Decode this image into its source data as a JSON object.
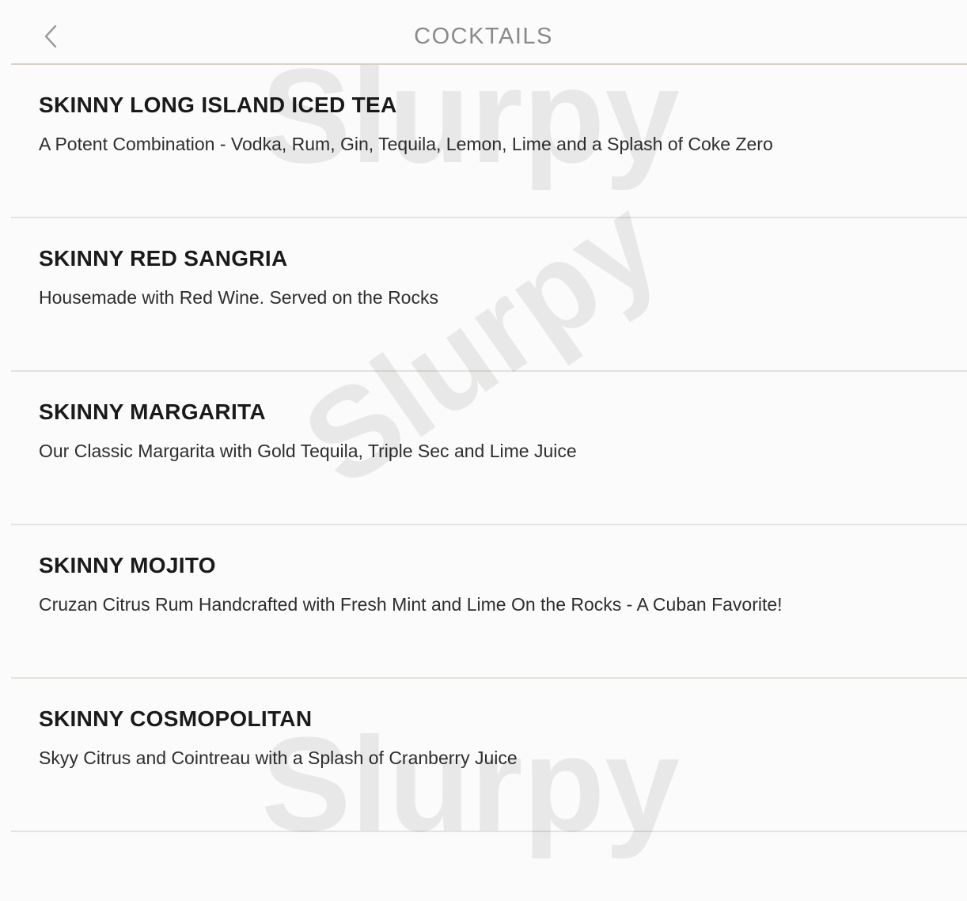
{
  "header": {
    "title": "COCKTAILS",
    "back_icon": "chevron-left-icon"
  },
  "menu": {
    "items": [
      {
        "name": "SKINNY LONG ISLAND ICED TEA",
        "description": "A Potent Combination - Vodka, Rum, Gin, Tequila, Lemon, Lime and a Splash of Coke Zero"
      },
      {
        "name": "SKINNY RED SANGRIA",
        "description": "Housemade with Red Wine. Served on the Rocks"
      },
      {
        "name": "SKINNY MARGARITA",
        "description": "Our Classic Margarita with Gold Tequila, Triple Sec and Lime Juice"
      },
      {
        "name": "SKINNY MOJITO",
        "description": "Cruzan Citrus Rum Handcrafted with Fresh Mint and Lime On the Rocks - A Cuban Favorite!"
      },
      {
        "name": "SKINNY COSMOPOLITAN",
        "description": "Skyy Citrus and Cointreau with a Splash of Cranberry Juice"
      }
    ]
  },
  "watermark": {
    "text": "Slurpy"
  },
  "colors": {
    "background": "#fbfbfb",
    "title": "#8a8a8a",
    "name": "#1a1a1a",
    "description": "#2e2e2e",
    "divider": "#e4e2dc",
    "watermark_accent": "#f08a24"
  }
}
